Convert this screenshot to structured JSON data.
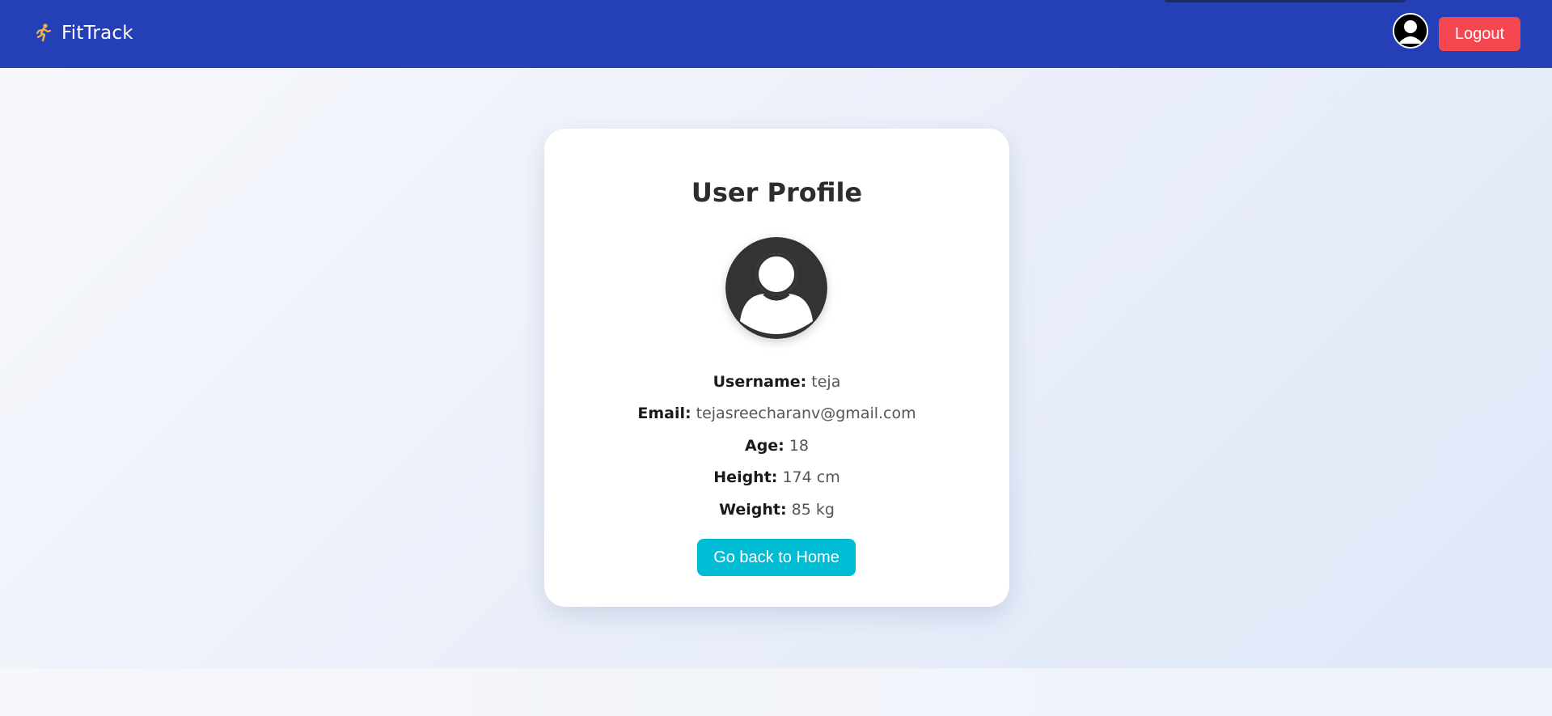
{
  "navbar": {
    "brand_name": "FitTrack",
    "brand_icon": "running-person-icon",
    "avatar_icon": "user-avatar-icon",
    "logout_label": "Logout",
    "colors": {
      "background": "#2540b7",
      "logout": "#f4474f"
    }
  },
  "profile": {
    "title": "User Profile",
    "avatar_icon": "user-avatar-icon",
    "fields": [
      {
        "label": "Username:",
        "value": "teja"
      },
      {
        "label": "Email:",
        "value": "tejasreecharanv@gmail.com"
      },
      {
        "label": "Age:",
        "value": "18"
      },
      {
        "label": "Height:",
        "value": "174 cm"
      },
      {
        "label": "Weight:",
        "value": "85 kg"
      }
    ],
    "home_button_label": "Go back to Home",
    "colors": {
      "home_button": "#00bcd4",
      "avatar": "#333333"
    }
  }
}
